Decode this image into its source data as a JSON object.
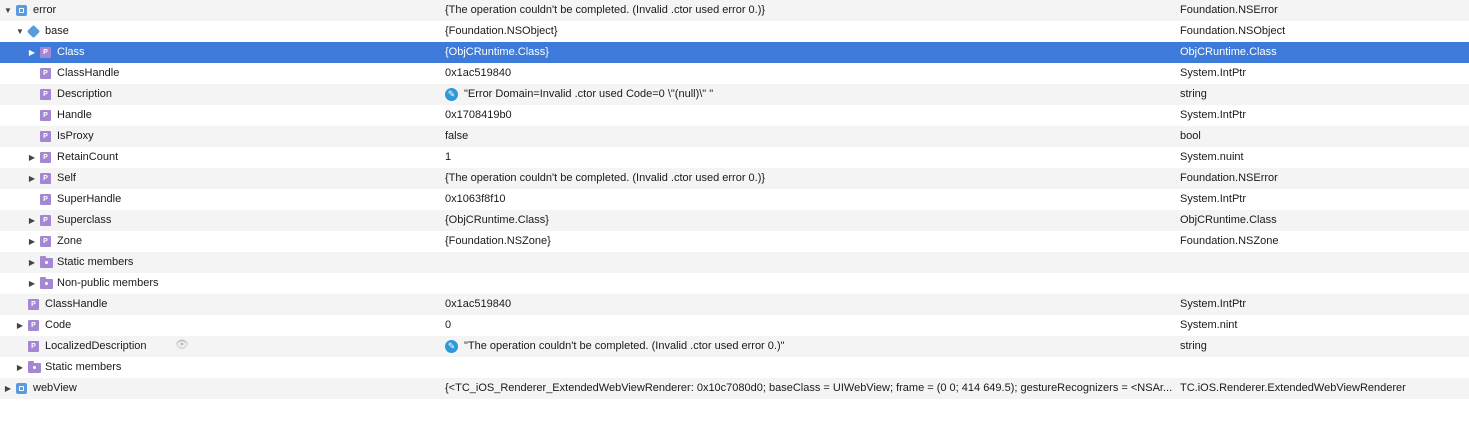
{
  "rows": [
    {
      "name": "error",
      "value": "{The operation couldn't be completed. (Invalid .ctor used error 0.)}",
      "type": "Foundation.NSError",
      "icon": "object-icon",
      "disclosure": "expanded",
      "level": 0
    },
    {
      "name": "base",
      "value": "{Foundation.NSObject}",
      "type": "Foundation.NSObject",
      "icon": "base-class-icon",
      "disclosure": "expanded",
      "level": 1
    },
    {
      "name": "Class",
      "value": "{ObjCRuntime.Class}",
      "type": "ObjCRuntime.Class",
      "icon": "property-icon",
      "disclosure": "collapsed",
      "level": 2,
      "selected": true
    },
    {
      "name": "ClassHandle",
      "value": "0x1ac519840",
      "type": "System.IntPtr",
      "icon": "property-icon",
      "disclosure": "none",
      "level": 2
    },
    {
      "name": "Description",
      "value": "\"Error Domain=Invalid .ctor used Code=0 \\\"(null)\\\" \"",
      "type": "string",
      "icon": "property-icon",
      "disclosure": "none",
      "level": 2,
      "editable": true
    },
    {
      "name": "Handle",
      "value": "0x1708419b0",
      "type": "System.IntPtr",
      "icon": "property-icon",
      "disclosure": "none",
      "level": 2
    },
    {
      "name": "IsProxy",
      "value": "false",
      "type": "bool",
      "icon": "property-icon",
      "disclosure": "none",
      "level": 2
    },
    {
      "name": "RetainCount",
      "value": "1",
      "type": "System.nuint",
      "icon": "property-icon",
      "disclosure": "collapsed",
      "level": 2
    },
    {
      "name": "Self",
      "value": "{The operation couldn't be completed. (Invalid .ctor used error 0.)}",
      "type": "Foundation.NSError",
      "icon": "property-icon",
      "disclosure": "collapsed",
      "level": 2
    },
    {
      "name": "SuperHandle",
      "value": "0x1063f8f10",
      "type": "System.IntPtr",
      "icon": "property-icon",
      "disclosure": "none",
      "level": 2
    },
    {
      "name": "Superclass",
      "value": "{ObjCRuntime.Class}",
      "type": "ObjCRuntime.Class",
      "icon": "property-icon",
      "disclosure": "collapsed",
      "level": 2
    },
    {
      "name": "Zone",
      "value": "{Foundation.NSZone}",
      "type": "Foundation.NSZone",
      "icon": "property-icon",
      "disclosure": "collapsed",
      "level": 2
    },
    {
      "name": "Static members",
      "value": "",
      "type": "",
      "icon": "folder-icon",
      "disclosure": "collapsed",
      "level": 2
    },
    {
      "name": "Non-public members",
      "value": "",
      "type": "",
      "icon": "folder-icon",
      "disclosure": "collapsed",
      "level": 2
    },
    {
      "name": "ClassHandle",
      "value": "0x1ac519840",
      "type": "System.IntPtr",
      "icon": "property-icon",
      "disclosure": "none",
      "level": 1
    },
    {
      "name": "Code",
      "value": "0",
      "type": "System.nint",
      "icon": "property-icon",
      "disclosure": "collapsed",
      "level": 1
    },
    {
      "name": "LocalizedDescription",
      "value": "\"The operation couldn't be completed. (Invalid .ctor used error 0.)\"",
      "type": "string",
      "icon": "property-icon",
      "disclosure": "none",
      "level": 1,
      "editable": true,
      "eye": true
    },
    {
      "name": "Static members",
      "value": "",
      "type": "",
      "icon": "folder-icon",
      "disclosure": "collapsed",
      "level": 1
    },
    {
      "name": "webView",
      "value": "{<TC_iOS_Renderer_ExtendedWebViewRenderer: 0x10c7080d0; baseClass = UIWebView; frame = (0 0; 414 649.5); gestureRecognizers = <NSAr...",
      "type": "TC.iOS.Renderer.ExtendedWebViewRenderer",
      "icon": "object-icon",
      "disclosure": "collapsed",
      "level": 0
    }
  ],
  "icon_glyphs": {
    "property-icon": "P",
    "expanded": "▼",
    "collapsed": "▶",
    "edit-icon": "✎",
    "eye-icon": "👁"
  },
  "colors": {
    "selection": "#3d7ad9",
    "stripe": "#f4f4f4",
    "property": "#a487d2",
    "object": "#5b9bdc"
  }
}
